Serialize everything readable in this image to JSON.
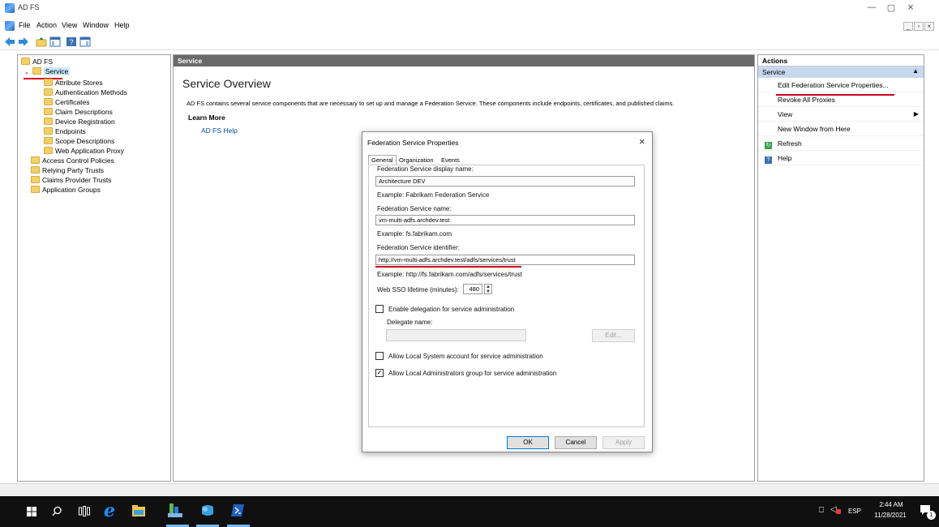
{
  "window": {
    "title": "AD FS"
  },
  "menu": [
    "File",
    "Action",
    "View",
    "Window",
    "Help"
  ],
  "tree": {
    "root": "AD FS",
    "service": "Service",
    "service_children": [
      "Attribute Stores",
      "Authentication Methods",
      "Certificates",
      "Claim Descriptions",
      "Device Registration",
      "Endpoints",
      "Scope Descriptions",
      "Web Application Proxy"
    ],
    "others": [
      "Access Control Policies",
      "Relying Party Trusts",
      "Claims Provider Trusts",
      "Application Groups"
    ]
  },
  "center": {
    "header": "Service",
    "title": "Service Overview",
    "description": "AD FS contains several service components that are necessary to set up and manage a Federation Service. These components include endpoints, certificates, and published claims.",
    "learn_more": "Learn More",
    "help_link": "AD FS Help"
  },
  "actions": {
    "header": "Actions",
    "section": "Service",
    "items": [
      "Edit Federation Service Properties...",
      "Revoke All Proxies",
      "View",
      "New Window from Here",
      "Refresh",
      "Help"
    ]
  },
  "dialog": {
    "title": "Federation Service Properties",
    "tabs": [
      "General",
      "Organization",
      "Events"
    ],
    "display_name_label": "Federation Service display name:",
    "display_name_value": "Architecture DEV",
    "display_name_example": "Example: Fabrikam Federation Service",
    "service_name_label": "Federation Service name:",
    "service_name_value": "vm-multi-adfs.archdev.test",
    "service_name_example": "Example: fs.fabrikam.com",
    "identifier_label": "Federation Service identifier:",
    "identifier_value": "http://vm-multi-adfs.archdev.test/adfs/services/trust",
    "identifier_example": "Example: http://fs.fabrikam.com/adfs/services/trust",
    "sso_label": "Web SSO lifetime (minutes):",
    "sso_value": "480",
    "delegation_label": "Enable delegation for service administration",
    "delegate_name_label": "Delegate name:",
    "edit_button": "Edit...",
    "local_system_label": "Allow Local System account for service administration",
    "local_admins_label": "Allow Local Administrators group for service administration",
    "local_admins_checked": "✓",
    "ok": "OK",
    "cancel": "Cancel",
    "apply": "Apply"
  },
  "taskbar": {
    "language": "ESP",
    "time": "2:44 AM",
    "date": "11/28/2021",
    "notification_count": "1"
  },
  "colors": {
    "accent": "#d0021b",
    "link": "#0050a0",
    "taskbar": "#101010"
  }
}
